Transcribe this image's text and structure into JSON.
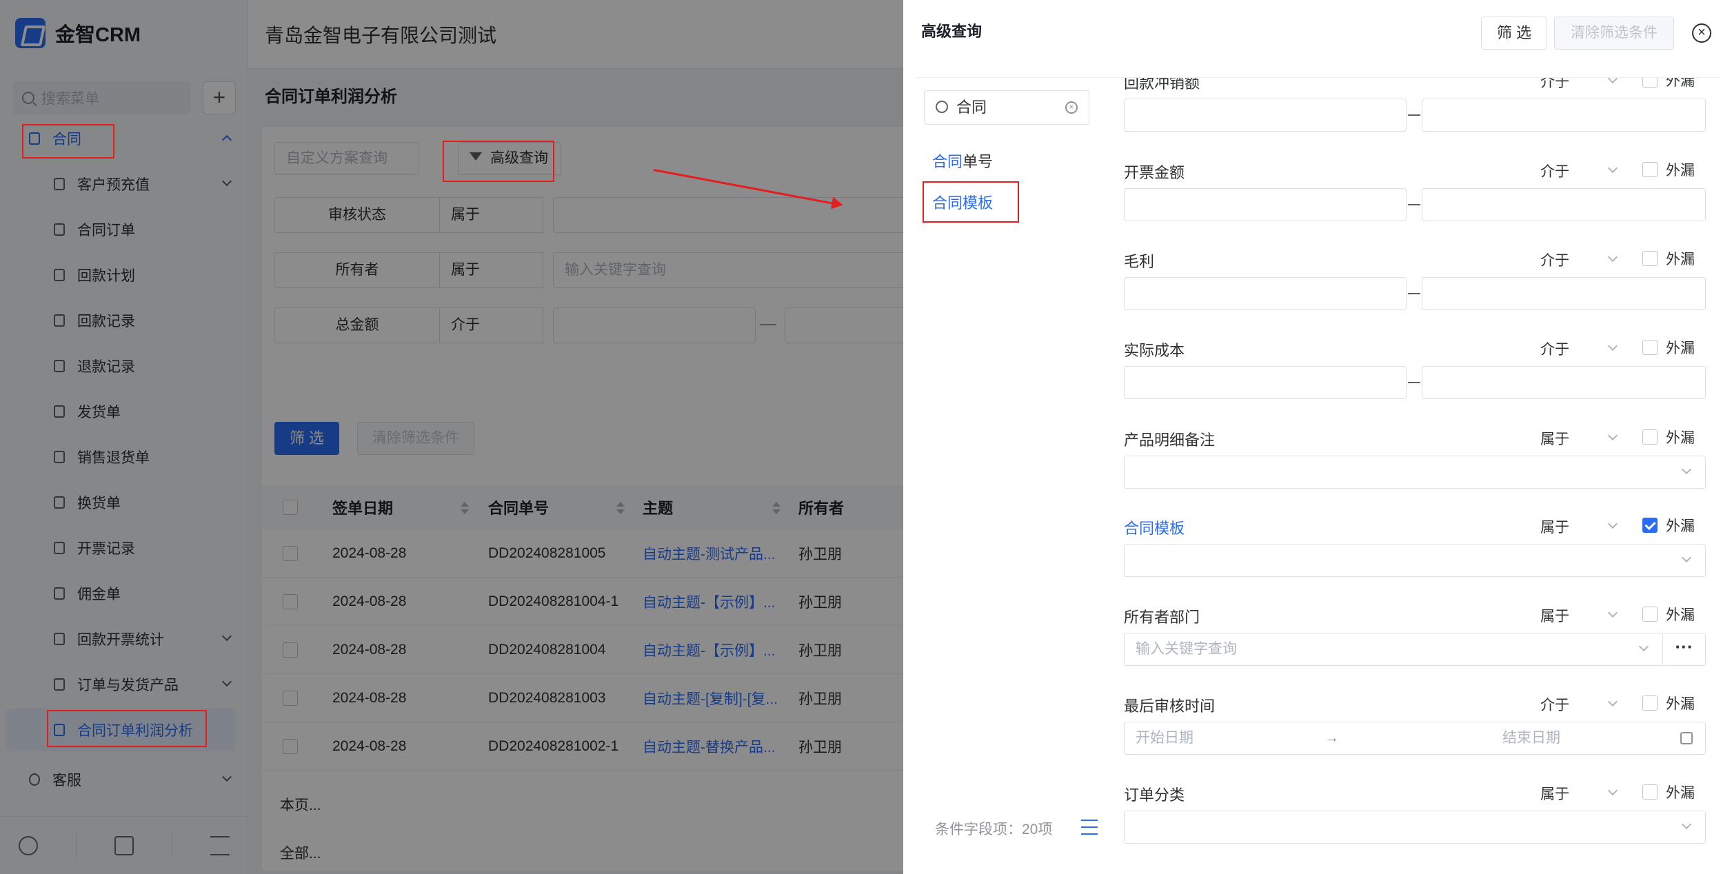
{
  "sidebar": {
    "brand": "金智CRM",
    "search_placeholder": "搜索菜单",
    "add_label": "+",
    "items": [
      {
        "label": "合同"
      },
      {
        "label": "客户预充值"
      },
      {
        "label": "合同订单"
      },
      {
        "label": "回款计划"
      },
      {
        "label": "回款记录"
      },
      {
        "label": "退款记录"
      },
      {
        "label": "发货单"
      },
      {
        "label": "销售退货单"
      },
      {
        "label": "换货单"
      },
      {
        "label": "开票记录"
      },
      {
        "label": "佣金单"
      },
      {
        "label": "回款开票统计"
      },
      {
        "label": "订单与发货产品"
      },
      {
        "label": "合同订单利润分析"
      },
      {
        "label": "客服"
      }
    ],
    "footer_icons": [
      "history-icon",
      "settings-sliders-icon",
      "collapse-menu-icon"
    ]
  },
  "header": {
    "company": "青岛金智电子有限公司测试"
  },
  "main": {
    "page_title": "合同订单利润分析",
    "scheme_placeholder": "自定义方案查询",
    "advanced_query": "高级查询",
    "filters": [
      {
        "name": "审核状态",
        "op": "属于",
        "value": ""
      },
      {
        "name": "所有者",
        "op": "属于",
        "value": "输入关键字查询"
      },
      {
        "name": "总金额",
        "op": "介于",
        "value": ""
      }
    ],
    "filter_btn": "筛 选",
    "clear_btn": "清除筛选条件",
    "table": {
      "columns": [
        "签单日期",
        "合同单号",
        "主题",
        "所有者"
      ],
      "rows": [
        [
          "2024-08-28",
          "DD202408281005",
          "自动主题-测试产品...",
          "孙卫朋"
        ],
        [
          "2024-08-28",
          "DD202408281004-1",
          "自动主题-【示例】...",
          "孙卫朋"
        ],
        [
          "2024-08-28",
          "DD202408281004",
          "自动主题-【示例】...",
          "孙卫朋"
        ],
        [
          "2024-08-28",
          "DD202408281003",
          "自动主题-[复制]-[复...",
          "孙卫朋"
        ],
        [
          "2024-08-28",
          "DD202408281002-1",
          "自动主题-替换产品...",
          "孙卫朋"
        ]
      ]
    },
    "page_sum": "本页...",
    "all_sum": "全部..."
  },
  "drawer": {
    "title": "高级查询",
    "filter_btn": "筛 选",
    "clear_btn": "清除筛选条件",
    "close_label": "×",
    "search_value": "合同",
    "field_list": [
      {
        "hit": "合同",
        "rest": "单号"
      },
      {
        "hit": "合同模板",
        "rest": ""
      }
    ],
    "cond_count": "条件字段项：20项",
    "fields": [
      {
        "label": "回款冲销额",
        "op": "介于",
        "check": "外漏"
      },
      {
        "label": "开票金额",
        "op": "介于",
        "check": "外漏"
      },
      {
        "label": "毛利",
        "op": "介于",
        "check": "外漏"
      },
      {
        "label": "实际成本",
        "op": "介于",
        "check": "外漏"
      },
      {
        "label": "产品明细备注",
        "op": "属于",
        "check": "外漏"
      },
      {
        "label": "合同模板",
        "op": "属于",
        "check": "外漏"
      },
      {
        "label": "所有者部门",
        "op": "属于",
        "check": "外漏",
        "placeholder": "输入关键字查询",
        "more": "···"
      },
      {
        "label": "最后审核时间",
        "op": "介于",
        "check": "外漏",
        "start": "开始日期",
        "arrow": "→",
        "end": "结束日期"
      },
      {
        "label": "订单分类",
        "op": "属于",
        "check": "外漏"
      }
    ]
  }
}
